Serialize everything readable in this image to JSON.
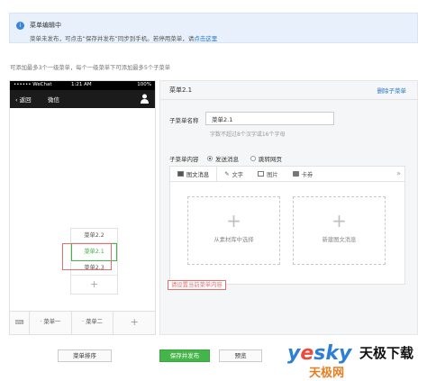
{
  "notice": {
    "icon": "info-icon",
    "title": "菜单编辑中",
    "body_text": "菜单未发布，可点击“保存并发布”同步到手机。若停用菜单，请",
    "link": "点击这里"
  },
  "hint": "可添加最多3个一级菜单，每个一级菜单下可添加最多5个子菜单",
  "phone": {
    "status": {
      "carrier": "•••••• WeChat",
      "time": "1:21 AM",
      "battery": "100%"
    },
    "back": "返回",
    "account_name": "微信",
    "submenu": [
      "菜单2.2",
      "菜单2.1",
      "菜单2.3"
    ],
    "tabbar": {
      "tab1": "菜单一",
      "tab2": "菜单二",
      "add": "+"
    }
  },
  "panel": {
    "title": "菜单2.1",
    "delete": "删除子菜单",
    "name_label": "子菜单名称",
    "name_value": "菜单2.1",
    "name_hint": "字数不超过8个汉字或16个字母",
    "content_label": "子菜单内容",
    "radio_send": "发送消息",
    "radio_jump": "跳转网页",
    "tabs": [
      "图文消息",
      "文字",
      "图片",
      "卡券"
    ],
    "more": "»",
    "card_select": "从素材库中选择",
    "card_new": "新建图文消息",
    "error": "请设置当前菜单内容"
  },
  "buttons": {
    "sort": "菜单排序",
    "publish": "保存并发布",
    "preview": "预览"
  },
  "watermark": {
    "brand": "yesky",
    "cn": "天极下载",
    "sub": "天极网"
  },
  "colors": {
    "accent_green": "#44b549",
    "link_blue": "#2a75c9",
    "error_red": "#e0706e"
  }
}
